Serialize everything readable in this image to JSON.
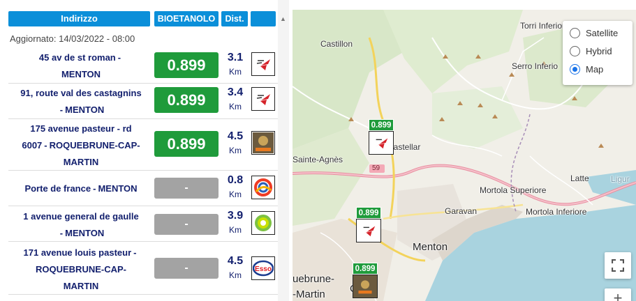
{
  "header": {
    "address": "Indirizzo",
    "fuel": "BIOETANOLO",
    "distance": "Dist.",
    "brand": ""
  },
  "updated": "Aggiornato: 14/03/2022 - 08:00",
  "stations": [
    {
      "line1": "45 av de st roman",
      "sep": "-",
      "line2": "MENTON",
      "price": "0.899",
      "status": "green",
      "dist": "3.1",
      "unit": "Km",
      "brand": "red-flame-icon"
    },
    {
      "line1": "91, route val des castagnins",
      "sep": "-",
      "line2": "MENTON",
      "price": "0.899",
      "status": "green",
      "dist": "3.4",
      "unit": "Km",
      "brand": "red-flame-icon"
    },
    {
      "line1": "175 avenue pasteur - rd",
      "line1b": "6007",
      "sep": "-",
      "line2": "ROQUEBRUNE-CAP-",
      "line3": "MARTIN",
      "price": "0.899",
      "status": "green",
      "dist": "4.5",
      "unit": "Km",
      "brand": "total-access-icon"
    },
    {
      "line1": "Porte de france",
      "sep": "-",
      "line2": "MENTON",
      "price": "-",
      "status": "grey",
      "dist": "0.8",
      "unit": "Km",
      "brand": "totalenergies-icon"
    },
    {
      "line1": "1 avenue general de gaulle",
      "sep": "-",
      "line2": "MENTON",
      "price": "-",
      "status": "grey",
      "dist": "3.9",
      "unit": "Km",
      "brand": "bp-icon"
    },
    {
      "line1": "171 avenue louis pasteur",
      "sep": "-",
      "line2": "ROQUEBRUNE-CAP-",
      "line3": "MARTIN",
      "price": "-",
      "status": "grey",
      "dist": "4.5",
      "unit": "Km",
      "brand": "esso-icon"
    }
  ],
  "map": {
    "places": [
      "Castillon",
      "Torri Inferiore",
      "Serro Inferio",
      "Castellar",
      "Sainte-Agnès",
      "Mortola Superiore",
      "Latte",
      "Ligur",
      "Garavan",
      "Mortola Inferiore",
      "Menton",
      "uebrune-",
      "-Martin",
      "Ca"
    ],
    "road": "59",
    "markers": [
      "0.899",
      "0.899",
      "0.899"
    ],
    "map_types": [
      "Satellite",
      "Hybrid",
      "Map"
    ],
    "selected_map_type": "Map",
    "zoom_in": "+"
  },
  "colors": {
    "header_blue": "#0b8fd9",
    "price_green": "#1f9b3b",
    "price_grey": "#a3a3a3",
    "address_navy": "#13206e"
  }
}
